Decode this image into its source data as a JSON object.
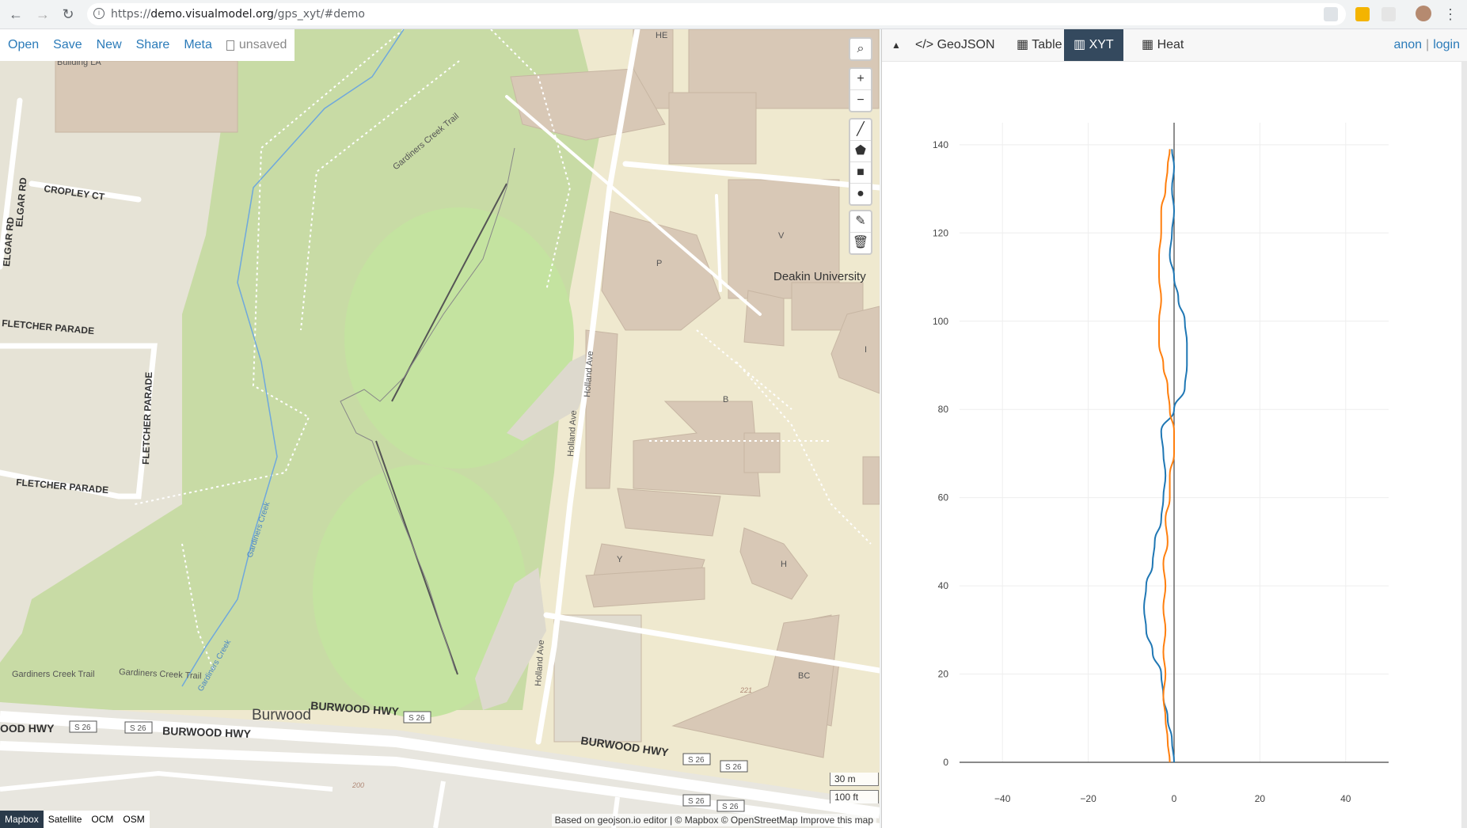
{
  "browser": {
    "url_prefix": "https://",
    "url_host": "demo.visualmodel.org",
    "url_path": "/gps_xyt/#demo"
  },
  "toolbar": {
    "open": "Open",
    "save": "Save",
    "new": "New",
    "share": "Share",
    "meta": "Meta",
    "status": "unsaved"
  },
  "map_controls": {
    "search": "search-icon",
    "zoom_in": "+",
    "zoom_out": "−",
    "draw_tools": [
      "line-icon",
      "polygon-icon",
      "rectangle-icon",
      "marker-icon",
      "edit-icon",
      "trash-icon"
    ]
  },
  "map_labels": {
    "elgar_rd": "ELGAR RD",
    "elgar_rd2": "ELGAR RD",
    "cropley_ct": "CROPLEY CT",
    "fletcher_parade_1": "FLETCHER PARADE",
    "fletcher_parade_2": "FLETCHER PARADE",
    "fletcher_parade_3": "FLETCHER PARADE",
    "gardiners_creek_trail_1": "Gardiners Creek Trail",
    "gardiners_creek_trail_2": "Gardiners Creek Trail",
    "gardiners_creek_trail_3": "Gardiners Creek Trail",
    "gardiners_creek_1": "Gardiners Creek",
    "gardiners_creek_2": "Gardiners Creek",
    "holland_ave_1": "Holland Ave",
    "holland_ave_2": "Holland Ave",
    "holland_ave_3": "Holland Ave",
    "deakin": "Deakin University",
    "burwood": "Burwood",
    "burwood_hwy_1": "BURWOOD HWY",
    "burwood_hwy_2": "BURWOOD HWY",
    "burwood_hwy_3": "BURWOOD HWY",
    "burwood_hwy_4": "OOD HWY",
    "s26": "S 26",
    "building_la": "Building LA",
    "he": "HE",
    "p": "P",
    "v": "V",
    "b": "B",
    "y": "Y",
    "h": "H",
    "bc": "BC",
    "i": "I",
    "n221": "221",
    "n200": "200"
  },
  "scale": {
    "metric": "30 m",
    "imperial": "100 ft"
  },
  "layers": [
    "Mapbox",
    "Satellite",
    "OCM",
    "OSM"
  ],
  "active_layer": "Mapbox",
  "attribution": "Based on geojson.io editor | © Mapbox © OpenStreetMap Improve this map",
  "panel": {
    "tabs": [
      {
        "label": "GeoJSON",
        "icon": "code-icon"
      },
      {
        "label": "Table",
        "icon": "table-icon"
      },
      {
        "label": "XYT",
        "icon": "chart-icon"
      },
      {
        "label": "Heat",
        "icon": "grid-icon"
      }
    ],
    "active_tab": "XYT",
    "auth_anon": "anon",
    "auth_sep": "|",
    "auth_login": "login"
  },
  "chart_data": {
    "type": "line",
    "title": "",
    "xlabel": "",
    "ylabel": "",
    "xlim": [
      -50,
      50
    ],
    "ylim": [
      0,
      145
    ],
    "xticks": [
      -40,
      -20,
      0,
      20,
      40
    ],
    "yticks": [
      0,
      20,
      40,
      60,
      80,
      100,
      120,
      140
    ],
    "grid": true,
    "colors": [
      "#1f77b4",
      "#ff7f0e"
    ],
    "series": [
      {
        "values": [
          {
            "t": 0,
            "v": 0
          },
          {
            "t": 5,
            "v": -0.5
          },
          {
            "t": 10,
            "v": -1.5
          },
          {
            "t": 15,
            "v": -2.5
          },
          {
            "t": 20,
            "v": -3
          },
          {
            "t": 25,
            "v": -5
          },
          {
            "t": 30,
            "v": -6.5
          },
          {
            "t": 35,
            "v": -7
          },
          {
            "t": 40,
            "v": -6.5
          },
          {
            "t": 45,
            "v": -5
          },
          {
            "t": 50,
            "v": -4.5
          },
          {
            "t": 55,
            "v": -3
          },
          {
            "t": 60,
            "v": -2.5
          },
          {
            "t": 65,
            "v": -2
          },
          {
            "t": 70,
            "v": -2.5
          },
          {
            "t": 75,
            "v": -3
          },
          {
            "t": 80,
            "v": 0
          },
          {
            "t": 85,
            "v": 2.5
          },
          {
            "t": 90,
            "v": 3
          },
          {
            "t": 95,
            "v": 3
          },
          {
            "t": 100,
            "v": 2.5
          },
          {
            "t": 105,
            "v": 1
          },
          {
            "t": 110,
            "v": 0
          },
          {
            "t": 115,
            "v": -1
          },
          {
            "t": 120,
            "v": -0.5
          },
          {
            "t": 125,
            "v": 0
          },
          {
            "t": 130,
            "v": -0.5
          },
          {
            "t": 135,
            "v": 0
          },
          {
            "t": 139,
            "v": -0.5
          }
        ]
      },
      {
        "values": [
          {
            "t": 0,
            "v": -1
          },
          {
            "t": 5,
            "v": -1.5
          },
          {
            "t": 10,
            "v": -2
          },
          {
            "t": 15,
            "v": -2.5
          },
          {
            "t": 20,
            "v": -2
          },
          {
            "t": 25,
            "v": -2.5
          },
          {
            "t": 30,
            "v": -2
          },
          {
            "t": 35,
            "v": -2.5
          },
          {
            "t": 40,
            "v": -2
          },
          {
            "t": 45,
            "v": -2.5
          },
          {
            "t": 50,
            "v": -1.5
          },
          {
            "t": 55,
            "v": -2
          },
          {
            "t": 60,
            "v": -1
          },
          {
            "t": 65,
            "v": -1
          },
          {
            "t": 70,
            "v": 0
          },
          {
            "t": 75,
            "v": 0
          },
          {
            "t": 80,
            "v": -1
          },
          {
            "t": 85,
            "v": -1.5
          },
          {
            "t": 90,
            "v": -2.5
          },
          {
            "t": 95,
            "v": -3.5
          },
          {
            "t": 100,
            "v": -3.5
          },
          {
            "t": 105,
            "v": -3
          },
          {
            "t": 110,
            "v": -3.5
          },
          {
            "t": 115,
            "v": -3.5
          },
          {
            "t": 120,
            "v": -3
          },
          {
            "t": 125,
            "v": -3
          },
          {
            "t": 130,
            "v": -2
          },
          {
            "t": 135,
            "v": -1.5
          },
          {
            "t": 139,
            "v": -1
          }
        ]
      }
    ]
  }
}
